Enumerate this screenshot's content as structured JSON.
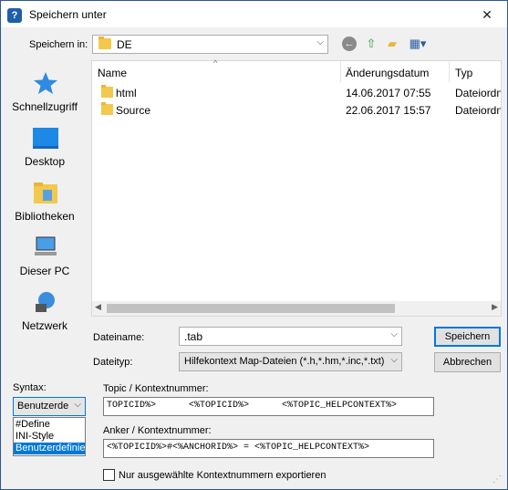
{
  "window": {
    "title": "Speichern unter",
    "close_glyph": "✕"
  },
  "toolbar": {
    "save_in_label": "Speichern in:",
    "save_in_value": "DE",
    "icons": [
      "back-icon",
      "up-folder-icon",
      "new-folder-icon",
      "view-menu-icon"
    ]
  },
  "places": [
    {
      "label": "Schnellzugriff",
      "icon": "star-icon"
    },
    {
      "label": "Desktop",
      "icon": "desktop-icon"
    },
    {
      "label": "Bibliotheken",
      "icon": "libraries-icon"
    },
    {
      "label": "Dieser PC",
      "icon": "computer-icon"
    },
    {
      "label": "Netzwerk",
      "icon": "network-icon"
    }
  ],
  "filelist": {
    "columns": [
      "Name",
      "Änderungsdatum",
      "Typ"
    ],
    "rows": [
      {
        "name": "html",
        "date": "14.06.2017 07:55",
        "type": "Dateiordner"
      },
      {
        "name": "Source",
        "date": "22.06.2017 15:57",
        "type": "Dateiordner"
      }
    ]
  },
  "filename": {
    "label": "Dateiname:",
    "value": ".tab"
  },
  "filetype": {
    "label": "Dateityp:",
    "value": "Hilfekontext Map-Dateien (*.h,*.hm,*.inc,*.txt)"
  },
  "buttons": {
    "save": "Speichern",
    "cancel": "Abbrechen"
  },
  "syntax": {
    "label": "Syntax:",
    "selected": "Benutzerde",
    "options": [
      "#Define",
      "INI-Style",
      "Benutzerdefinie"
    ],
    "selected_option_index": 2
  },
  "topic": {
    "label": "Topic / Kontextnummer:",
    "value": "TOPICID%>      <%TOPICID%>      <%TOPIC_HELPCONTEXT%>"
  },
  "anchor": {
    "label": "Anker / Kontextnummer:",
    "value": "<%TOPICID%>#<%ANCHORID%> = <%TOPIC_HELPCONTEXT%>"
  },
  "export_checkbox": {
    "label": "Nur ausgewählte Kontextnummern exportieren",
    "checked": false
  },
  "colors": {
    "accent": "#0078d7",
    "folder": "#f2c94c"
  }
}
